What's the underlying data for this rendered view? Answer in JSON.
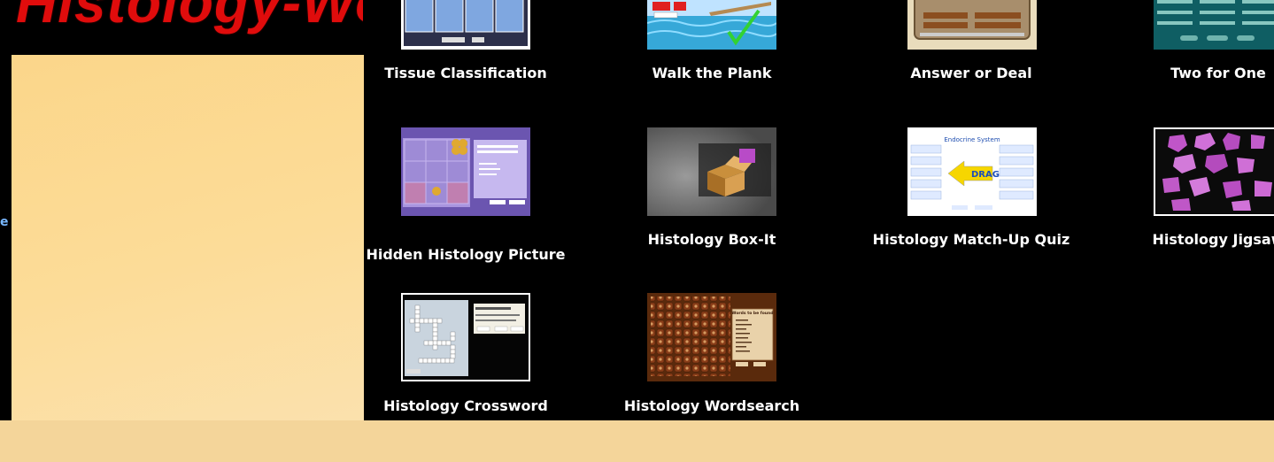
{
  "logo": {
    "text": "Histology-World!"
  },
  "sidebar": {
    "edge_text": "e"
  },
  "games": [
    {
      "label": "Tissue Classification",
      "icon": "tissue-classification-thumbnail"
    },
    {
      "label": "Walk the Plank",
      "icon": "walk-the-plank-thumbnail"
    },
    {
      "label": "Answer or Deal",
      "icon": "answer-or-deal-thumbnail"
    },
    {
      "label": "Two for One",
      "icon": "two-for-one-thumbnail"
    },
    {
      "label": "Hidden Histology Picture",
      "icon": "hidden-histology-picture-thumbnail"
    },
    {
      "label": "Histology Box-It",
      "icon": "histology-box-it-thumbnail"
    },
    {
      "label": "Histology Match-Up Quiz",
      "icon": "histology-match-up-thumbnail",
      "thumb_title": "Endocrine System",
      "thumb_word": "DRAG"
    },
    {
      "label": "Histology Jigsaw",
      "icon": "histology-jigsaw-thumbnail"
    },
    {
      "label": "Histology Crossword",
      "icon": "histology-crossword-thumbnail"
    },
    {
      "label": "Histology Wordsearch",
      "icon": "histology-wordsearch-thumbnail",
      "thumb_title": "Words to be found"
    }
  ],
  "colors": {
    "background": "#000000",
    "page": "#f4d59a",
    "logo": "#e00c0c",
    "caption": "#ffffff",
    "sidebar": "#fbd68a"
  }
}
